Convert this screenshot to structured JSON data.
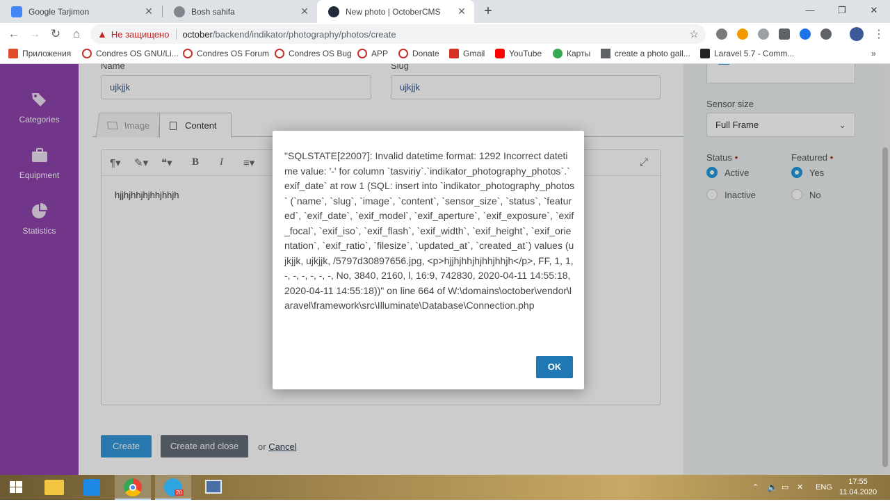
{
  "browser": {
    "tabs": [
      {
        "title": "Google Tarjimon",
        "active": false
      },
      {
        "title": "Bosh sahifa",
        "active": false
      },
      {
        "title": "New photo | OctoberCMS",
        "active": true
      }
    ],
    "newtab": "+",
    "window_controls": {
      "minimize": "—",
      "restore": "❐",
      "close": "✕"
    },
    "address": {
      "security_label": "Не защищено",
      "host": "october",
      "path": "/backend/indikator/photography/photos/create"
    },
    "bookmarks": [
      {
        "label": "Приложения",
        "color": "#e04b2a"
      },
      {
        "label": "Condres OS GNU/Li...",
        "color": "#c4302b"
      },
      {
        "label": "Condres OS Forum",
        "color": "#c4302b"
      },
      {
        "label": "Condres OS Bug",
        "color": "#c4302b"
      },
      {
        "label": "APP",
        "color": "#c4302b"
      },
      {
        "label": "Donate",
        "color": "#c4302b"
      },
      {
        "label": "Gmail",
        "color": "#d93025"
      },
      {
        "label": "YouTube",
        "color": "#ff0000"
      },
      {
        "label": "Карты",
        "color": "#34a853"
      },
      {
        "label": "create a photo gall...",
        "color": "#5f6368"
      },
      {
        "label": "Laravel 5.7 - Comm...",
        "color": "#222222"
      }
    ],
    "bookmarks_more": "»"
  },
  "sidebar": {
    "items": [
      {
        "label": "Categories",
        "icon": "tags-icon"
      },
      {
        "label": "Equipment",
        "icon": "briefcase-icon"
      },
      {
        "label": "Statistics",
        "icon": "pie-chart-icon"
      }
    ]
  },
  "form": {
    "name_label": "Name",
    "name_value": "ujkjjk",
    "slug_label": "Slug",
    "slug_value": "ujkjjk",
    "tabs": [
      {
        "label": "Image"
      },
      {
        "label": "Content"
      }
    ],
    "editor_content": "hjjhjhhjhjhhjhhjh",
    "toolbar": {
      "paragraph": "¶▾",
      "style": "✎▾",
      "quote": "❝▾",
      "bold": "B",
      "italic": "I",
      "align": "≡▾",
      "fullscreen": "⤢"
    },
    "create_button": "Create",
    "create_close_button": "Create and close",
    "or_text": "or",
    "cancel_link": "Cancel"
  },
  "secondary": {
    "sensor_size_label": "Sensor size",
    "sensor_size_value": "Full Frame",
    "status_label": "Status",
    "status_options": [
      "Active",
      "Inactive"
    ],
    "status_selected": "Active",
    "featured_label": "Featured",
    "featured_options": [
      "Yes",
      "No"
    ],
    "featured_selected": "Yes"
  },
  "modal": {
    "message": "\"SQLSTATE[22007]: Invalid datetime format: 1292 Incorrect datetime value: '-' for column `tasviriy`.`indikator_photography_photos`.`exif_date` at row 1 (SQL: insert into `indikator_photography_photos` (`name`, `slug`, `image`, `content`, `sensor_size`, `status`, `featured`, `exif_date`, `exif_model`, `exif_aperture`, `exif_exposure`, `exif_focal`, `exif_iso`, `exif_flash`, `exif_width`, `exif_height`, `exif_orientation`, `exif_ratio`, `filesize`, `updated_at`, `created_at`) values (ujkjjk, ujkjjk, /5797d30897656.jpg, <p>hjjhjhhjhjhhjhhjh</p>, FF, 1, 1, -, -, -, -, -, -, No, 3840, 2160, l, 16:9, 742830, 2020-04-11 14:55:18, 2020-04-11 14:55:18))\" on line 664 of W:\\domains\\october\\vendor\\laravel\\framework\\src\\Illuminate\\Database\\Connection.php",
    "ok_label": "OK"
  },
  "taskbar": {
    "language": "ENG",
    "time": "17:55",
    "date": "11.04.2020",
    "telegram_badge": "20"
  }
}
